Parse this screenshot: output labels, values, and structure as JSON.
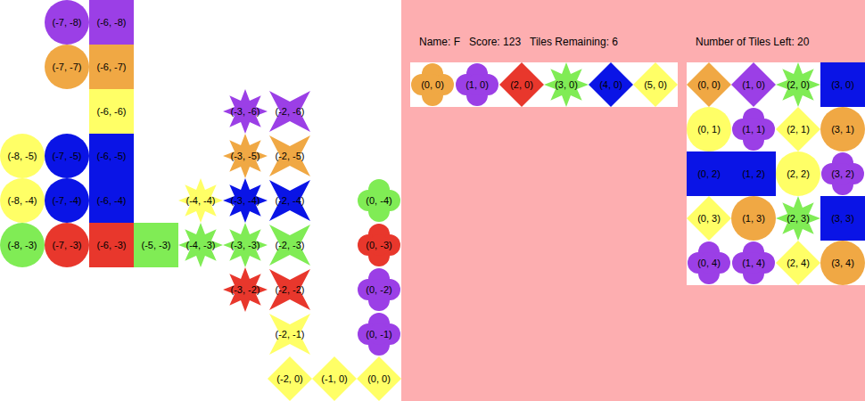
{
  "board": {
    "tiles": [
      {
        "label": "(-7, -8)",
        "col": -7,
        "row": -8,
        "kind": "circle",
        "color": "#9b3fe6"
      },
      {
        "label": "(-6, -8)",
        "col": -6,
        "row": -8,
        "kind": "square",
        "color": "#9b3fe6"
      },
      {
        "label": "(-7, -7)",
        "col": -7,
        "row": -7,
        "kind": "circle",
        "color": "#f0a844"
      },
      {
        "label": "(-6, -7)",
        "col": -6,
        "row": -7,
        "kind": "square",
        "color": "#f0a844"
      },
      {
        "label": "(-6, -6)",
        "col": -6,
        "row": -6,
        "kind": "square",
        "color": "#ffff66"
      },
      {
        "label": "(-8, -5)",
        "col": -8,
        "row": -5,
        "kind": "circle",
        "color": "#ffff66"
      },
      {
        "label": "(-7, -5)",
        "col": -7,
        "row": -5,
        "kind": "circle",
        "color": "#0a14e6"
      },
      {
        "label": "(-6, -5)",
        "col": -6,
        "row": -5,
        "kind": "square",
        "color": "#0a14e6"
      },
      {
        "label": "(-8, -4)",
        "col": -8,
        "row": -4,
        "kind": "circle",
        "color": "#ffff66"
      },
      {
        "label": "(-7, -4)",
        "col": -7,
        "row": -4,
        "kind": "circle",
        "color": "#0a14e6"
      },
      {
        "label": "(-6, -4)",
        "col": -6,
        "row": -4,
        "kind": "square",
        "color": "#0a14e6"
      },
      {
        "label": "(-8, -3)",
        "col": -8,
        "row": -3,
        "kind": "circle",
        "color": "#80ec55"
      },
      {
        "label": "(-7, -3)",
        "col": -7,
        "row": -3,
        "kind": "circle",
        "color": "#e8372c"
      },
      {
        "label": "(-6, -3)",
        "col": -6,
        "row": -3,
        "kind": "square",
        "color": "#e8372c"
      },
      {
        "label": "(-5, -3)",
        "col": -5,
        "row": -3,
        "kind": "square",
        "color": "#80ec55"
      },
      {
        "label": "(-4, -3)",
        "col": -4,
        "row": -3,
        "kind": "star8",
        "color": "#80ec55"
      },
      {
        "label": "(-4, -4)",
        "col": -4,
        "row": -4,
        "kind": "star8",
        "color": "#ffff66"
      },
      {
        "label": "(-3, -6)",
        "col": -3,
        "row": -6,
        "kind": "star8",
        "color": "#9b3fe6"
      },
      {
        "label": "(-2, -6)",
        "col": -2,
        "row": -6,
        "kind": "star4",
        "color": "#9b3fe6"
      },
      {
        "label": "(-3, -5)",
        "col": -3,
        "row": -5,
        "kind": "star8",
        "color": "#f0a844"
      },
      {
        "label": "(-2, -5)",
        "col": -2,
        "row": -5,
        "kind": "star4",
        "color": "#f0a844"
      },
      {
        "label": "(-3, -4)",
        "col": -3,
        "row": -4,
        "kind": "star8",
        "color": "#0a14e6"
      },
      {
        "label": "(-2, -4)",
        "col": -2,
        "row": -4,
        "kind": "star4",
        "color": "#0a14e6"
      },
      {
        "label": "(-3, -3)",
        "col": -3,
        "row": -3,
        "kind": "star8",
        "color": "#80ec55"
      },
      {
        "label": "(-2, -3)",
        "col": -2,
        "row": -3,
        "kind": "star4",
        "color": "#80ec55"
      },
      {
        "label": "(-3, -2)",
        "col": -3,
        "row": -2,
        "kind": "star8",
        "color": "#e8372c"
      },
      {
        "label": "(-2, -2)",
        "col": -2,
        "row": -2,
        "kind": "star4",
        "color": "#e8372c"
      },
      {
        "label": "(-2, -1)",
        "col": -2,
        "row": -1,
        "kind": "star4",
        "color": "#ffff66"
      },
      {
        "label": "(-2, 0)",
        "col": -2,
        "row": 0,
        "kind": "diamond",
        "color": "#ffff66"
      },
      {
        "label": "(-1, 0)",
        "col": -1,
        "row": 0,
        "kind": "diamond",
        "color": "#ffff66"
      },
      {
        "label": "(0, 0)",
        "col": 0,
        "row": 0,
        "kind": "diamond",
        "color": "#ffff66"
      },
      {
        "label": "(0, -4)",
        "col": 0,
        "row": -4,
        "kind": "clover",
        "color": "#80ec55"
      },
      {
        "label": "(0, -3)",
        "col": 0,
        "row": -3,
        "kind": "clover",
        "color": "#e8372c"
      },
      {
        "label": "(0, -2)",
        "col": 0,
        "row": -2,
        "kind": "clover",
        "color": "#9b3fe6"
      },
      {
        "label": "(0, -1)",
        "col": 0,
        "row": -1,
        "kind": "clover",
        "color": "#9b3fe6"
      }
    ]
  },
  "player": {
    "name_label": "Name: F",
    "score_label": "Score: 123",
    "tiles_remaining_label": "Tiles Remaining: 6",
    "hand": [
      {
        "label": "(0, 0)",
        "kind": "clover",
        "color": "#f0a844"
      },
      {
        "label": "(1, 0)",
        "kind": "clover",
        "color": "#9b3fe6"
      },
      {
        "label": "(2, 0)",
        "kind": "diamond",
        "color": "#e8372c"
      },
      {
        "label": "(3, 0)",
        "kind": "star8",
        "color": "#80ec55"
      },
      {
        "label": "(4, 0)",
        "kind": "diamond",
        "color": "#0a14e6"
      },
      {
        "label": "(5, 0)",
        "kind": "diamond",
        "color": "#ffff66"
      }
    ]
  },
  "bag": {
    "label": "Number of Tiles Left: 20",
    "tiles": [
      {
        "label": "(0, 0)",
        "kind": "diamond",
        "color": "#f0a844"
      },
      {
        "label": "(1, 0)",
        "kind": "diamond",
        "color": "#9b3fe6"
      },
      {
        "label": "(2, 0)",
        "kind": "star8",
        "color": "#80ec55"
      },
      {
        "label": "(3, 0)",
        "kind": "square",
        "color": "#0a14e6"
      },
      {
        "label": "(0, 1)",
        "kind": "circle",
        "color": "#ffff66"
      },
      {
        "label": "(1, 1)",
        "kind": "clover",
        "color": "#9b3fe6"
      },
      {
        "label": "(2, 1)",
        "kind": "diamond",
        "color": "#ffff66"
      },
      {
        "label": "(3, 1)",
        "kind": "circle",
        "color": "#f0a844"
      },
      {
        "label": "(0, 2)",
        "kind": "square",
        "color": "#0a14e6"
      },
      {
        "label": "(1, 2)",
        "kind": "square",
        "color": "#0a14e6"
      },
      {
        "label": "(2, 2)",
        "kind": "circle",
        "color": "#ffff66"
      },
      {
        "label": "(3, 2)",
        "kind": "clover",
        "color": "#9b3fe6"
      },
      {
        "label": "(0, 3)",
        "kind": "diamond",
        "color": "#ffff66"
      },
      {
        "label": "(1, 3)",
        "kind": "circle",
        "color": "#f0a844"
      },
      {
        "label": "(2, 3)",
        "kind": "star8",
        "color": "#80ec55"
      },
      {
        "label": "(3, 3)",
        "kind": "square",
        "color": "#0a14e6"
      },
      {
        "label": "(0, 4)",
        "kind": "clover",
        "color": "#9b3fe6"
      },
      {
        "label": "(1, 4)",
        "kind": "clover",
        "color": "#9b3fe6"
      },
      {
        "label": "(2, 4)",
        "kind": "diamond",
        "color": "#ffff66"
      },
      {
        "label": "(3, 4)",
        "kind": "circle",
        "color": "#f0a844"
      }
    ]
  }
}
